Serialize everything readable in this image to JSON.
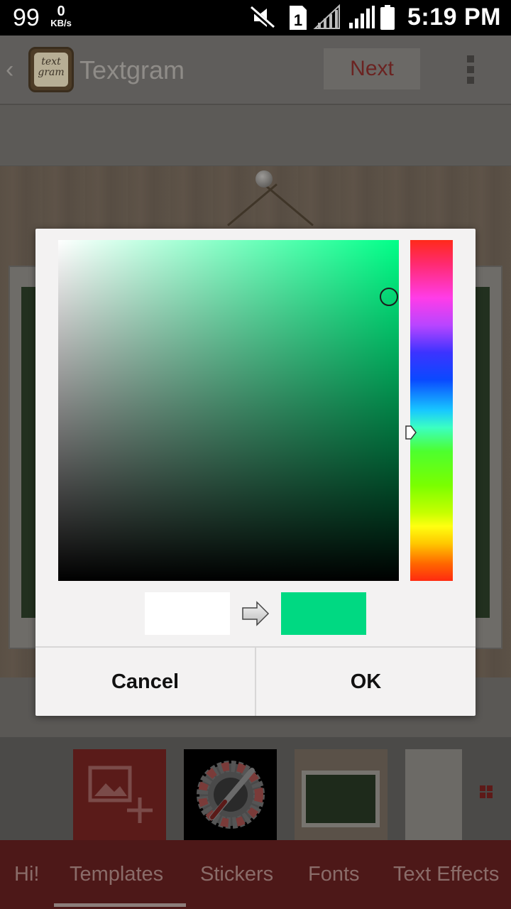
{
  "status_bar": {
    "notification_count": "99",
    "net_speed_value": "0",
    "net_speed_unit": "KB/s",
    "sim_slot": "1",
    "time": "5:19 PM"
  },
  "app_bar": {
    "title": "Textgram",
    "logo_text_line1": "text",
    "logo_text_line2": "gram",
    "next_label": "Next"
  },
  "color_dialog": {
    "current_color": "#00d982",
    "previous_color": "#ffffff",
    "hue_base_color": "#00ff88",
    "cancel_label": "Cancel",
    "ok_label": "OK"
  },
  "bottom_tabs": {
    "items": [
      "Hi!",
      "Templates",
      "Stickers",
      "Fonts",
      "Text Effects"
    ],
    "selected": "Templates"
  },
  "colors": {
    "accent_dark_red": "#4d1818",
    "dialog_background": "#f3f2f2"
  }
}
